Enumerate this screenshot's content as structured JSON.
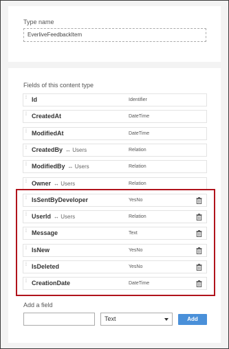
{
  "type_name": {
    "label": "Type name",
    "value": "EverliveFeedbackItem"
  },
  "fields_section": {
    "label": "Fields of this content type",
    "fields": [
      {
        "name": "Id",
        "relation": "",
        "type": "Identifier",
        "deletable": false
      },
      {
        "name": "CreatedAt",
        "relation": "",
        "type": "DateTime",
        "deletable": false
      },
      {
        "name": "ModifiedAt",
        "relation": "",
        "type": "DateTime",
        "deletable": false
      },
      {
        "name": "CreatedBy",
        "relation": "↔ Users",
        "type": "Relation",
        "deletable": false
      },
      {
        "name": "ModifiedBy",
        "relation": "↔ Users",
        "type": "Relation",
        "deletable": false
      },
      {
        "name": "Owner",
        "relation": "↔ Users",
        "type": "Relation",
        "deletable": false
      },
      {
        "name": "IsSentByDeveloper",
        "relation": "",
        "type": "YesNo",
        "deletable": true
      },
      {
        "name": "UserId",
        "relation": "↔ Users",
        "type": "Relation",
        "deletable": true
      },
      {
        "name": "Message",
        "relation": "",
        "type": "Text",
        "deletable": true
      },
      {
        "name": "IsNew",
        "relation": "",
        "type": "YesNo",
        "deletable": true
      },
      {
        "name": "IsDeleted",
        "relation": "",
        "type": "YesNo",
        "deletable": true
      },
      {
        "name": "CreationDate",
        "relation": "",
        "type": "DateTime",
        "deletable": true
      }
    ]
  },
  "add_field": {
    "label": "Add a field",
    "name_value": "",
    "type_selected": "Text",
    "button_label": "Add"
  },
  "colors": {
    "highlight_border": "#b0121b",
    "add_button": "#4a90d9"
  }
}
